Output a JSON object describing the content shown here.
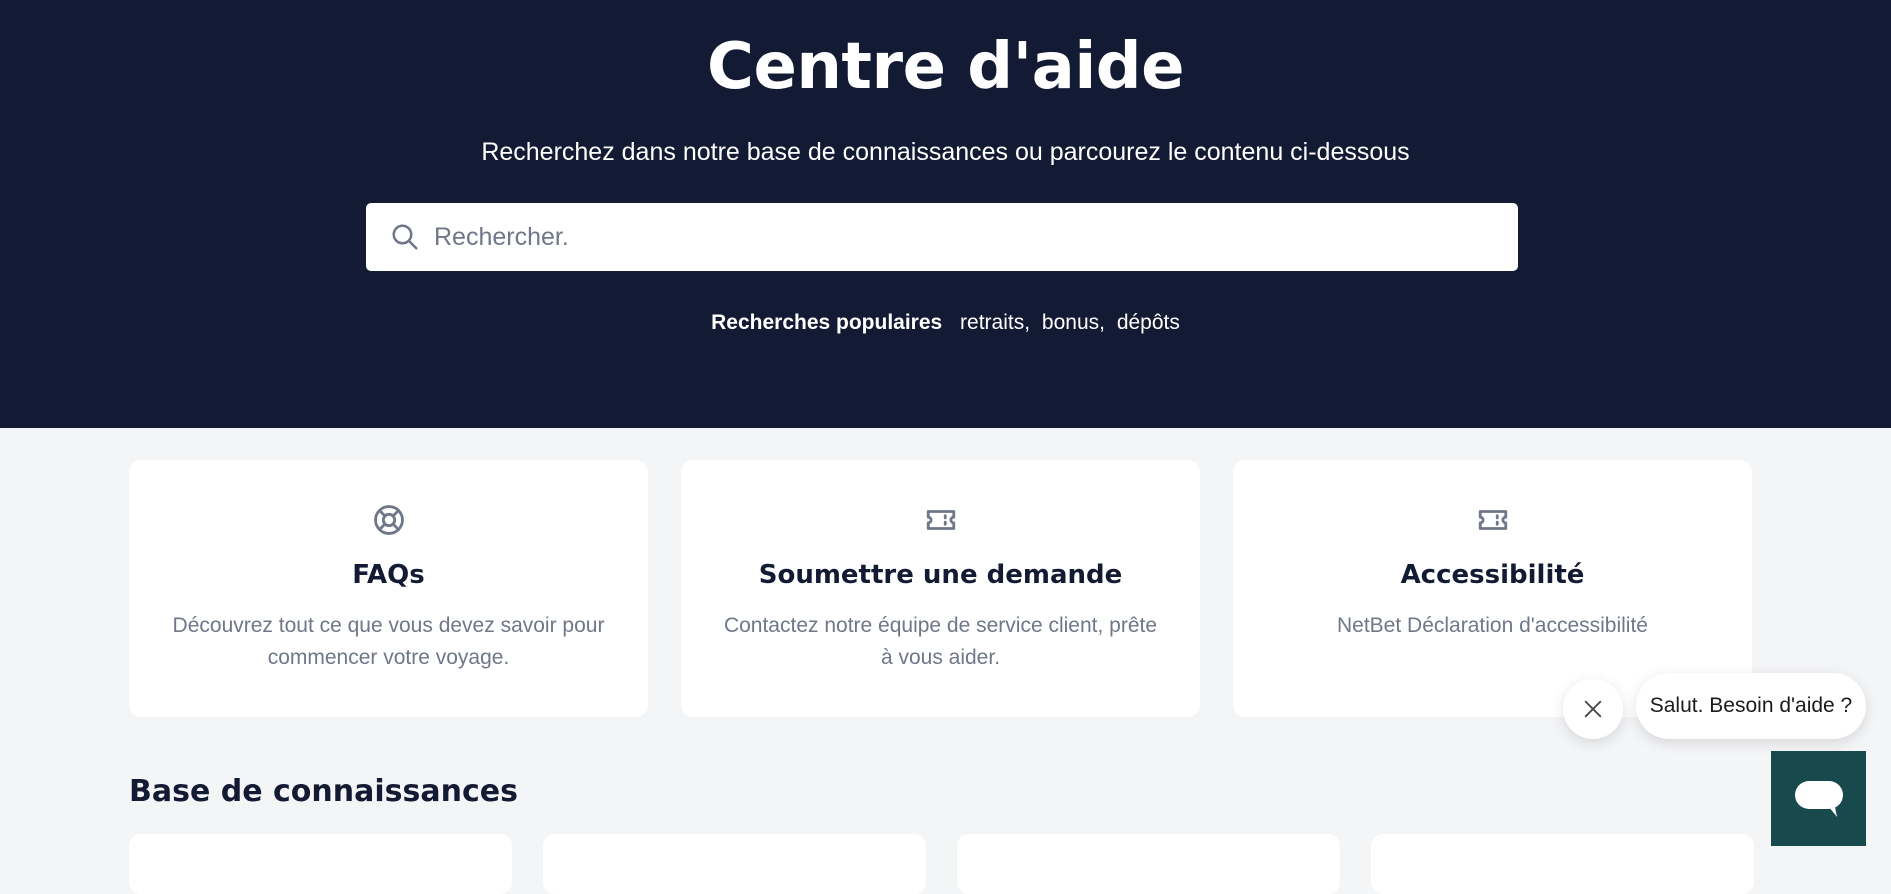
{
  "hero": {
    "title": "Centre d'aide",
    "subtitle": "Recherchez dans notre base de connaissances ou parcourez le contenu ci-dessous",
    "search_placeholder": "Rechercher.",
    "popular_label": "Recherches populaires",
    "popular_links": [
      "retraits,",
      "bonus,",
      "dépôts"
    ]
  },
  "cards": [
    {
      "icon": "lifebuoy-icon",
      "title": "FAQs",
      "description": "Découvrez tout ce que vous devez savoir pour commencer votre voyage."
    },
    {
      "icon": "ticket-icon",
      "title": "Soumettre une demande",
      "description": "Contactez notre équipe de service client, prête à vous aider."
    },
    {
      "icon": "ticket-icon",
      "title": "Accessibilité",
      "description": "NetBet Déclaration d'accessibilité"
    }
  ],
  "knowledge_base": {
    "title": "Base de connaissances"
  },
  "chat": {
    "greeting": "Salut. Besoin d'aide ?",
    "launcher_icon": "chat-bubble-icon",
    "close_icon": "close-icon"
  },
  "colors": {
    "hero_bg": "#131a33",
    "page_bg": "#f4f5f7",
    "text_dark": "#131a33",
    "text_muted": "#6f7789",
    "chat_launcher": "#17494d"
  }
}
